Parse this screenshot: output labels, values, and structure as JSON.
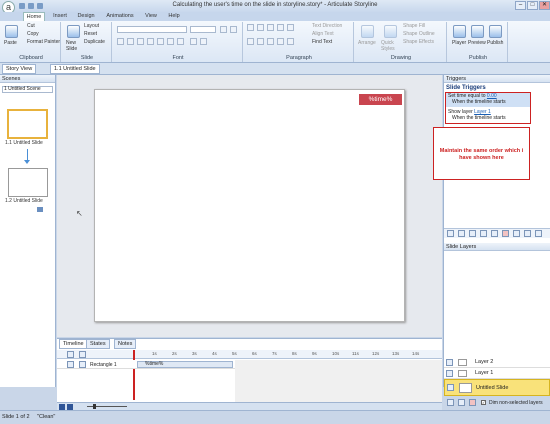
{
  "window": {
    "title": "Calculating the user's time on the slide in storyline.story* - Articulate Storyline",
    "logo": "a",
    "minimize": "–",
    "maximize": "□",
    "close": "✕"
  },
  "tabs": [
    "Home",
    "Insert",
    "Design",
    "Animations",
    "View",
    "Help"
  ],
  "ribbon": {
    "clipboard": {
      "paste": "Paste",
      "cut": "Cut",
      "copy": "Copy",
      "format_painter": "Format Painter",
      "label": "Clipboard"
    },
    "slide": {
      "new_slide": "New Slide",
      "layout": "Layout",
      "reset": "Reset",
      "duplicate": "Duplicate",
      "label": "Slide"
    },
    "font": {
      "label": "Font"
    },
    "paragraph": {
      "text_direction": "Text Direction",
      "align_text": "Align Text",
      "find_text": "Find Text",
      "label": "Paragraph"
    },
    "drawing": {
      "arrange": "Arrange",
      "quick_styles": "Quick Styles",
      "shape_fill": "Shape Fill",
      "shape_outline": "Shape Outline",
      "shape_effects": "Shape Effects",
      "label": "Drawing"
    },
    "publish": {
      "player": "Player",
      "preview": "Preview",
      "publish": "Publish",
      "label": "Publish"
    }
  },
  "doc_tabs": {
    "story_view": "Story View",
    "slide_tab": "1.1 Untitled Slide"
  },
  "scenes": {
    "header": "Scenes",
    "dropdown": "1 Untitled Scene",
    "slide1": "1.1 Untitled Slide",
    "slide2": "1.2 Untitled Slide"
  },
  "slide": {
    "variable": "%time%"
  },
  "triggers": {
    "header": "Triggers",
    "section": "Slide Triggers",
    "t1_prefix": "Set time equal to",
    "t1_value": "0.00",
    "t1_when": "When the timeline starts",
    "t2_prefix": "Show layer",
    "t2_value": "Layer 1",
    "t2_when": "When the timeline starts"
  },
  "callout": "Maintain the same order which i have shown here",
  "layers": {
    "header": "Slide Layers",
    "items": [
      "Layer 2",
      "Layer 1",
      "Untitled Slide"
    ],
    "dim_label": "Dim non-selected layers"
  },
  "timeline": {
    "tabs": [
      "Timeline",
      "States",
      "Notes"
    ],
    "row_label": "Rectangle 1",
    "row_text": "%time%",
    "ticks": [
      "1s",
      "2s",
      "3s",
      "4s",
      "5s",
      "6s",
      "7s",
      "8s",
      "9s",
      "10s",
      "11s",
      "12s",
      "13s",
      "14s"
    ]
  },
  "status": {
    "slide_info": "Slide 1 of 2",
    "theme": "\"Clean\""
  }
}
